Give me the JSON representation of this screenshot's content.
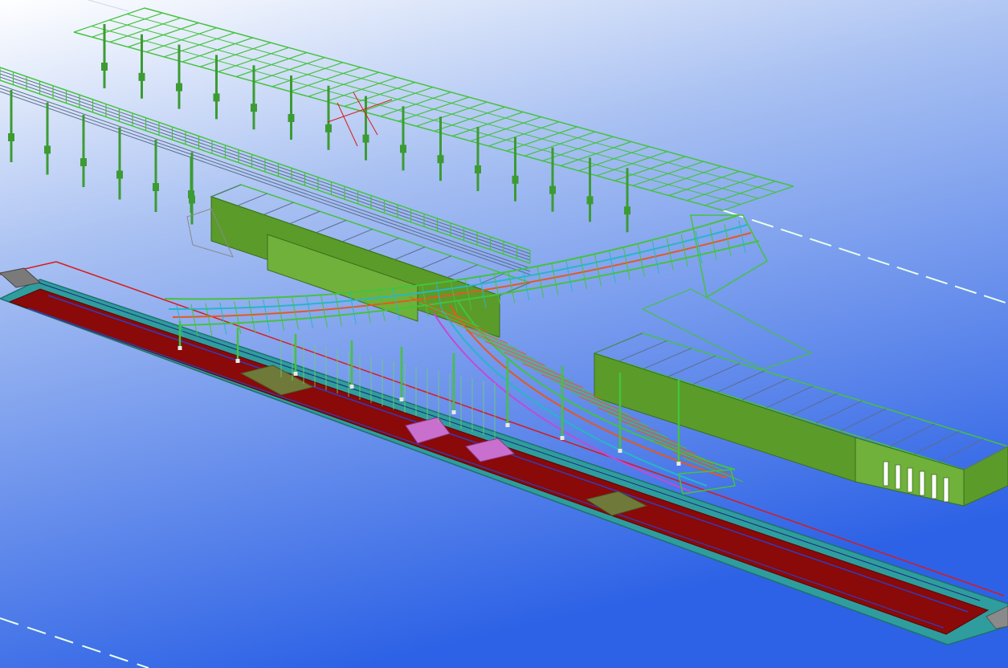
{
  "viewport": {
    "background": {
      "top": "#ffffff",
      "mid": "#a9c1f2",
      "bottom": "#2d62e6"
    },
    "view_mode": "3d-isometric-model"
  },
  "colors": {
    "steel_green": "#45c23e",
    "steel_dark": "#2f8f2a",
    "column_green": "#3c9b33",
    "wall_fill": "#5b9b2a",
    "wall_top": "#6fb13a",
    "wall_edge": "#3a6d1c",
    "roof_grid": "#5a6e8c",
    "platform_red": "#8a0909",
    "platform_teal": "#2f9d9d",
    "platform_edge": "#1f6f6f",
    "platform_blue_line": "#2c3fbf",
    "red_line": "#d81b1b",
    "member_orange": "#e25a1f",
    "member_cyan": "#27b6c8",
    "member_magenta": "#c04bd6",
    "magenta_plate": "#c970cf",
    "olive_plate": "#6f7a3a",
    "dashed_grid": "#e8ffef"
  }
}
